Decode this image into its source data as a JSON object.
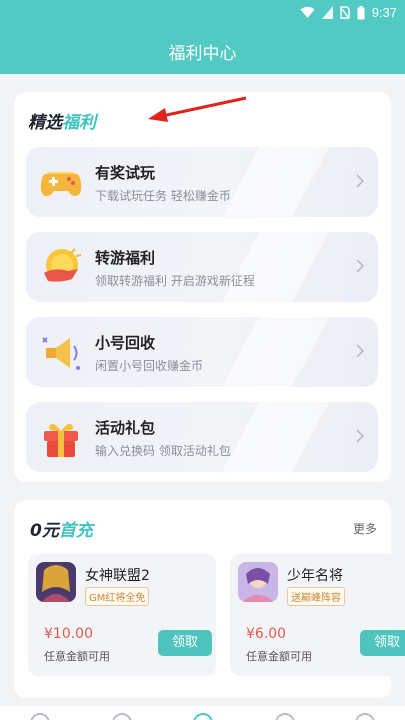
{
  "status_bar": {
    "time": "9:37",
    "icons": [
      "wifi-icon",
      "signal-icon",
      "no-sim-icon",
      "battery-icon"
    ]
  },
  "header": {
    "title": "福利中心"
  },
  "welfare": {
    "title_part1": "精选",
    "title_part2": "福利",
    "items": [
      {
        "icon": "gamepad-icon",
        "title": "有奖试玩",
        "subtitle": "下载试玩任务 轻松赚金币"
      },
      {
        "icon": "coin-transfer-icon",
        "title": "转游福利",
        "subtitle": "领取转游福利 开启游戏新征程"
      },
      {
        "icon": "megaphone-icon",
        "title": "小号回收",
        "subtitle": "闲置小号回收赚金币"
      },
      {
        "icon": "gift-box-icon",
        "title": "活动礼包",
        "subtitle": "输入兑换码 领取活动礼包"
      }
    ]
  },
  "zero_charge": {
    "title_part1": "0元",
    "title_part2": "首充",
    "more_label": "更多",
    "games": [
      {
        "name": "女神联盟2",
        "tag": "GM红将全免",
        "price": "¥10.00",
        "desc": "任意金额可用",
        "button": "领取"
      },
      {
        "name": "少年名将",
        "tag": "送巅峰阵容",
        "price": "¥6.00",
        "desc": "任意金额可用",
        "button": "领取"
      }
    ]
  },
  "colors": {
    "brand": "#53c9c3",
    "accent_text": "#3fc3bb",
    "price": "#e35b4e",
    "button": "#4fc4be"
  }
}
